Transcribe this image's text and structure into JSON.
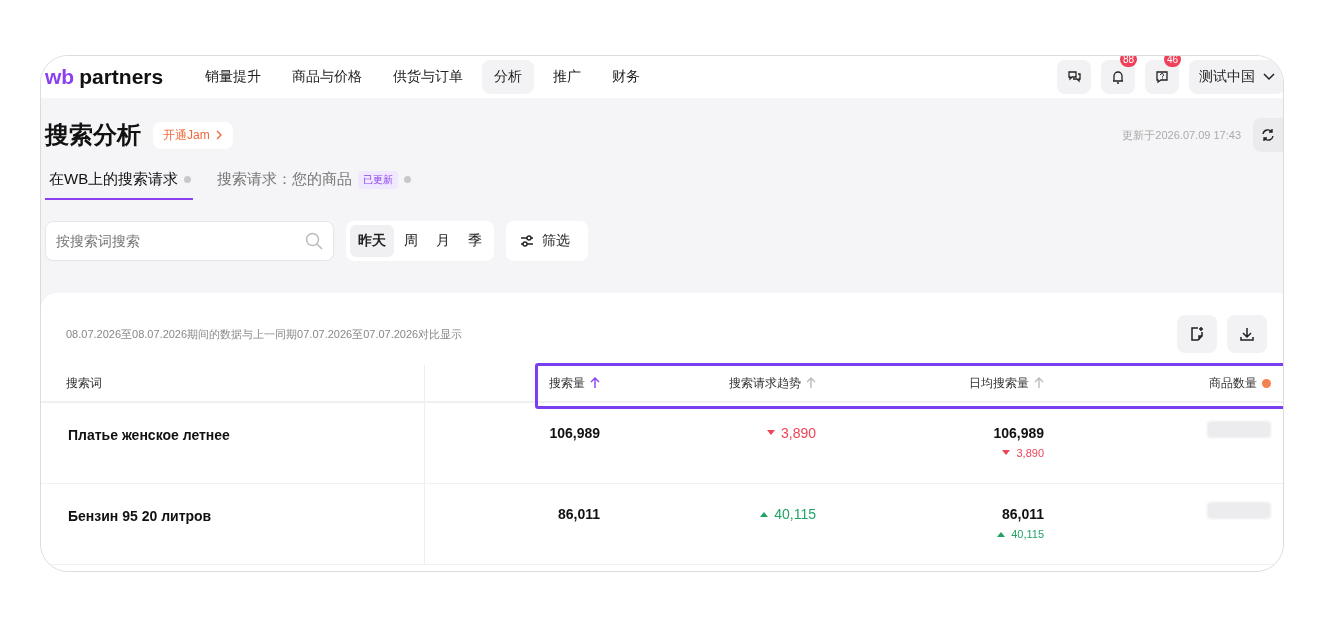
{
  "logo": {
    "mark": "wb",
    "name": "partners"
  },
  "nav": [
    {
      "label": "销量提升",
      "selected": false
    },
    {
      "label": "商品与价格",
      "selected": false
    },
    {
      "label": "供货与订单",
      "selected": false
    },
    {
      "label": "分析",
      "selected": true
    },
    {
      "label": "推广",
      "selected": false
    },
    {
      "label": "财务",
      "selected": false
    }
  ],
  "header_actions": {
    "notifications_badge": "88",
    "help_badge": "46",
    "account": "测试中国"
  },
  "page": {
    "title": "搜索分析",
    "promo_link": "开通Jam",
    "updated": "更新于2026.07.09 17:43"
  },
  "tabs": [
    {
      "label": "在WB上的搜索请求",
      "selected": true
    },
    {
      "label": "搜索请求：您的商品",
      "selected": false,
      "badge": "已更新"
    }
  ],
  "search": {
    "placeholder": "按搜索词搜索"
  },
  "periods": [
    {
      "label": "昨天",
      "selected": true
    },
    {
      "label": "周",
      "selected": false
    },
    {
      "label": "月",
      "selected": false
    },
    {
      "label": "季",
      "selected": false
    }
  ],
  "filter_button": "筛选",
  "table": {
    "caption": "08.07.2026至08.07.2026期间的数据与上一同期07.07.2026至07.07.2026对比显示",
    "columns": [
      {
        "label": "搜索词",
        "kind": "plain"
      },
      {
        "label": "搜索量",
        "kind": "sortable",
        "sorted": true
      },
      {
        "label": "搜索请求趋势",
        "kind": "sortable",
        "sorted": false
      },
      {
        "label": "日均搜索量",
        "kind": "sortable",
        "sorted": false
      },
      {
        "label": "商品数量",
        "kind": "flagged"
      }
    ],
    "rows": [
      {
        "term": "Платье женское летнее",
        "volume": "106,989",
        "trend": {
          "kind": "down",
          "value": "3,890"
        },
        "daily": "106,989",
        "daily_trend": {
          "kind": "down",
          "value": "3,890"
        },
        "products_hidden": true
      },
      {
        "term": "Бензин 95 20 литров",
        "volume": "86,011",
        "trend": {
          "kind": "up",
          "value": "40,115"
        },
        "daily": "86,011",
        "daily_trend": {
          "kind": "up",
          "value": "40,115"
        },
        "products_hidden": true
      }
    ]
  }
}
